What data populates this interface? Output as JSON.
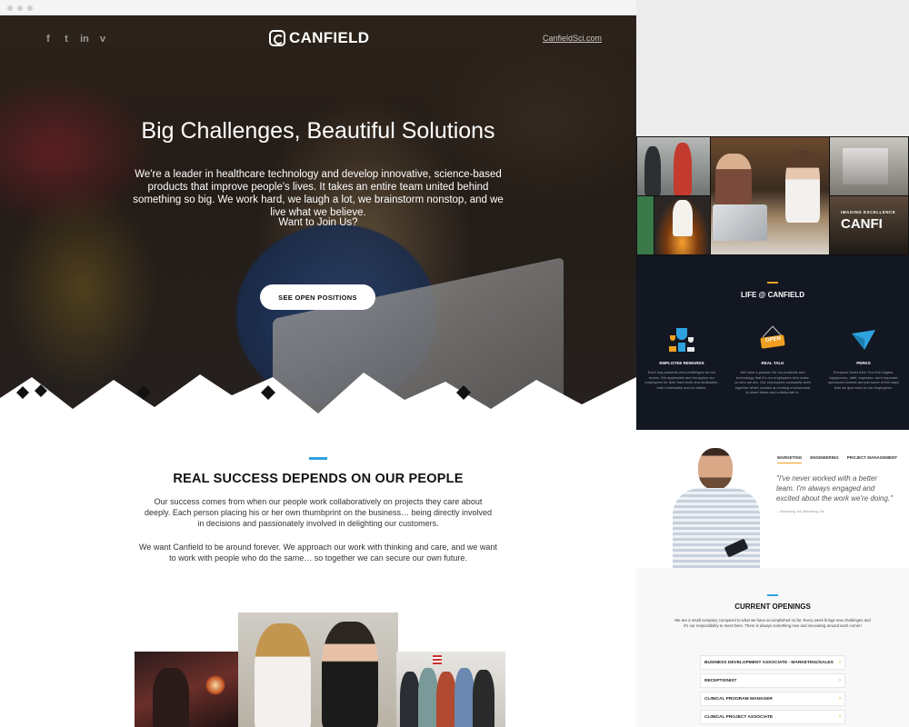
{
  "header": {
    "social": [
      "f",
      "t",
      "in",
      "v"
    ],
    "brand": "CANFIELD",
    "site_link": "CanfieldSci.com"
  },
  "hero": {
    "title": "Big Challenges, Beautiful Solutions",
    "paragraph": "We're a leader in healthcare technology and develop innovative, science-based products that improve people's lives. It takes an entire team united behind something so big. We work hard, we laugh a lot, we brainstorm nonstop, and we live what we believe.",
    "cta_text": "Want to Join Us?",
    "button_label": "SEE OPEN POSITIONS"
  },
  "people": {
    "title": "REAL SUCCESS DEPENDS ON OUR PEOPLE",
    "p1": "Our success comes from when our people work collaboratively on projects they care about deeply. Each person placing his or her own thumbprint on the business… being directly involved in decisions and passionately involved in delighting our customers.",
    "p2": "We want Canfield to be around forever. We approach our work with thinking and care, and we want to work with people who do the same… so together we can secure our own future."
  },
  "collage": {
    "sign_line1": "IMAGING EXCELLENCE",
    "sign_line2": "CANFI"
  },
  "life": {
    "title": "LIFE @ CANFIELD",
    "perks": [
      {
        "title": "EMPLOYEE REWARDS",
        "desc": "Each day presents new challenges for our teams. We appreciate and recognize our employees for their hard work and dedication, both individually and on teams.",
        "icon": "trophy-icon"
      },
      {
        "title": "REAL TALK",
        "desc": "We have a passion for our products and technology that it's our employees who make us who we are. Our employees constantly work together which creates an inviting environment to share ideas and collaborate in.",
        "icon": "open-sign-icon",
        "sign": "OPEN"
      },
      {
        "title": "PERKS",
        "desc": "Everyone loves free! Our free bagels, cappuccino, latte, espresso, and corporate sponsored events are just some of the ways that we give back to our employees.",
        "icon": "paper-plane-icon"
      }
    ]
  },
  "testimonial": {
    "tabs": [
      "MARKETING",
      "ENGINEERING",
      "PROJECT MANAGEMENT"
    ],
    "active_tab": 0,
    "quote": "\"I've never worked with a better team. I'm always engaged and excited about the work we're doing.\"",
    "author": "– Marketing Job Marketing Job"
  },
  "openings": {
    "title": "CURRENT OPENINGS",
    "description": "We are a small company compared to what we have accomplished so far. Every week brings new challenges and it's our responsibility to meet them. There is always something new and innovating around each corner!",
    "jobs": [
      "BUSINESS DEVELOPMENT ASSOCIATE - MARKETING/SALES",
      "RECEPTIONIST",
      "CLINICAL PROGRAM MANAGER",
      "CLINICAL PROJECT ASSOCIATE"
    ]
  },
  "colors": {
    "accent_blue": "#2ea3e0",
    "accent_orange": "#f0a020",
    "dark_section": "#131722"
  }
}
